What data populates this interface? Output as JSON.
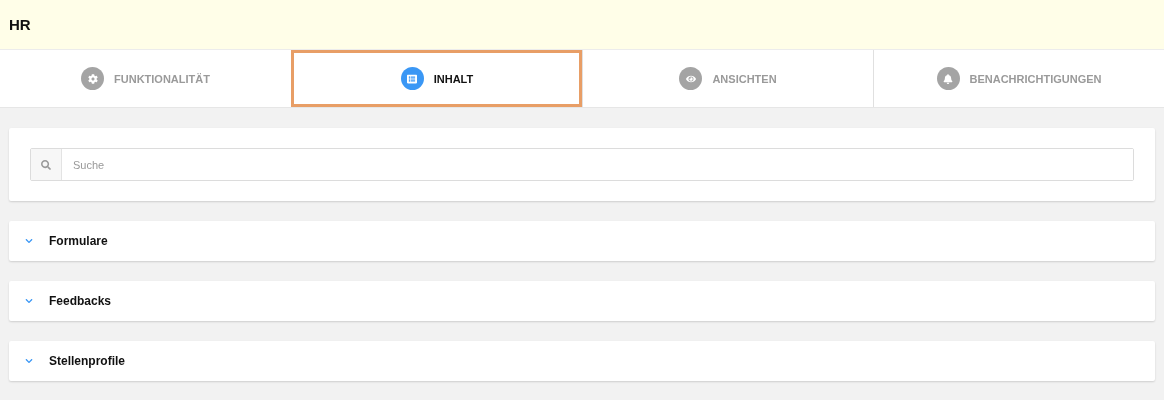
{
  "header": {
    "title": "HR"
  },
  "tabs": [
    {
      "label": "FUNKTIONALITÄT",
      "selected": false
    },
    {
      "label": "INHALT",
      "selected": true
    },
    {
      "label": "ANSICHTEN",
      "selected": false
    },
    {
      "label": "BENACHRICHTIGUNGEN",
      "selected": false
    }
  ],
  "search": {
    "placeholder": "Suche"
  },
  "sections": [
    {
      "title": "Formulare",
      "expanded": false
    },
    {
      "title": "Feedbacks",
      "expanded": false
    },
    {
      "title": "Stellenprofile",
      "expanded": false
    }
  ]
}
